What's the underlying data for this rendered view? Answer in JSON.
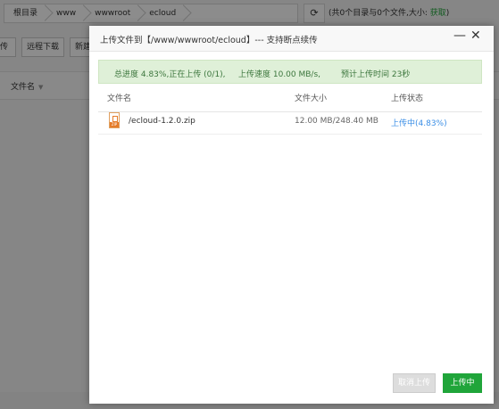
{
  "breadcrumb": [
    "根目录",
    "www",
    "wwwroot",
    "ecloud"
  ],
  "refresh_icon": "refresh-icon",
  "dir_summary": {
    "text": "(共0个目录与0个文件,大小: ",
    "fetch": "获取",
    "close": ")"
  },
  "toolbar": [
    "传",
    "远程下载",
    "新建"
  ],
  "list_header": {
    "filename": "文件名",
    "sort_icon": "caret-down-icon"
  },
  "dialog": {
    "title": "上传文件到【/www/wwwroot/ecloud】--- 支持断点续传",
    "minimize_icon": "minimize-icon",
    "close_icon": "close-icon",
    "progress": {
      "total": "总进度 4.83%,正在上传 (0/1),",
      "speed": "上传速度 10.00 MB/s,",
      "eta": "预计上传时间 23秒"
    },
    "columns": {
      "name": "文件名",
      "size": "文件大小",
      "status": "上传状态"
    },
    "files": [
      {
        "icon": "zip-file-icon",
        "name": "/ecloud-1.2.0.zip",
        "size": "12.00 MB/248.40 MB",
        "status": "上传中(4.83%)"
      }
    ],
    "cancel_label": "取消上传",
    "upload_label": "上传中"
  },
  "colors": {
    "accent": "#20a53a",
    "banner_bg": "#dff0d8",
    "status_link": "#3a8ee6"
  }
}
